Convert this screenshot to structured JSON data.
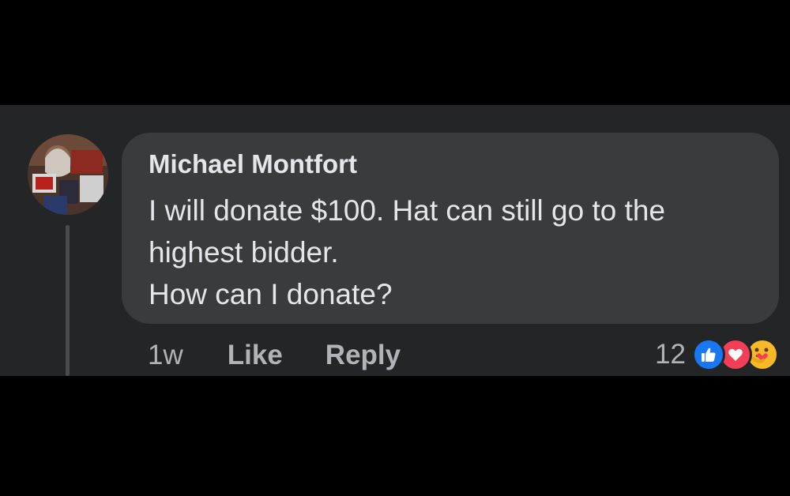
{
  "comment": {
    "author": "Michael Montfort",
    "lines": [
      "I will donate $100. Hat can still go to the",
      "highest bidder.",
      "How can I donate?"
    ],
    "time": "1w",
    "like_label": "Like",
    "reply_label": "Reply",
    "reaction_count": "12",
    "reactions": [
      "like-icon",
      "love-icon",
      "care-icon"
    ]
  },
  "colors": {
    "panel_bg": "#242526",
    "bubble_bg": "#3a3b3c",
    "text_primary": "#e4e6eb",
    "text_secondary": "#b0b3b8",
    "like_blue": "#1877f2",
    "love_red": "#f33e58",
    "care_yellow": "#f7b928"
  }
}
